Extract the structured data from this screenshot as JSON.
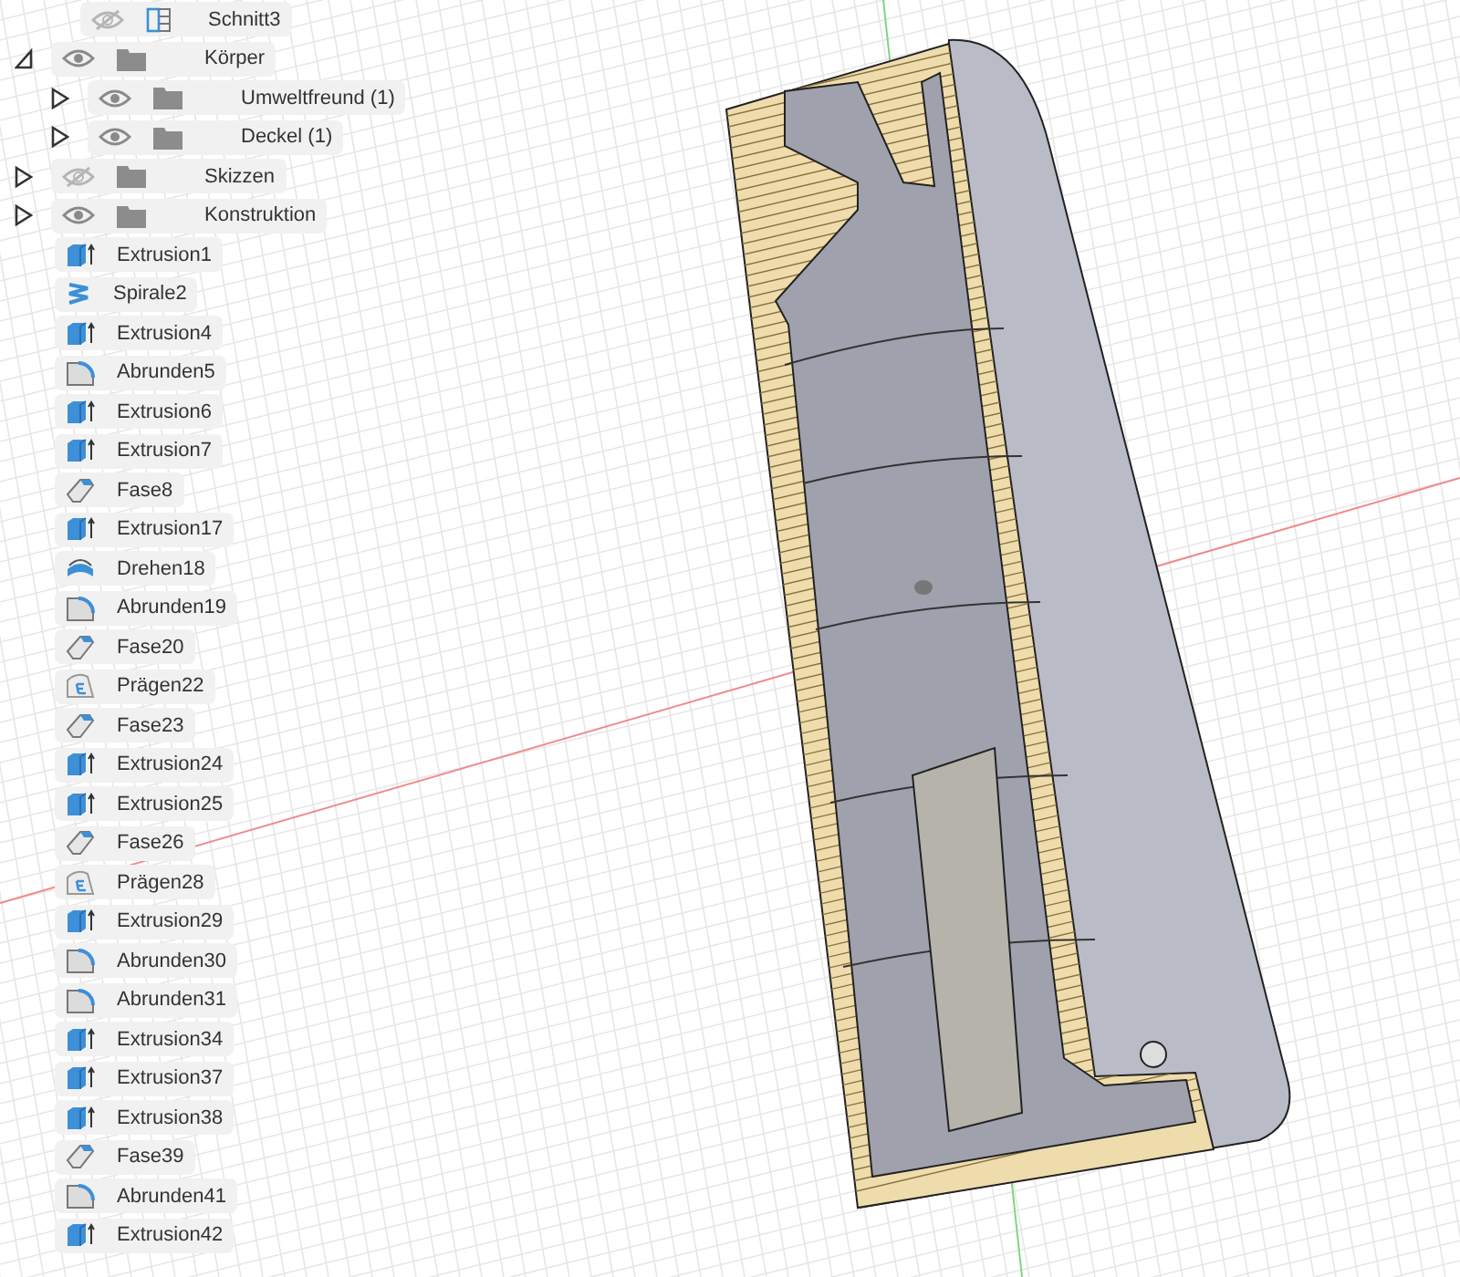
{
  "browser": {
    "sections": [
      {
        "name": "Schnitt3",
        "visible": false
      }
    ],
    "folders": [
      {
        "name": "Körper",
        "visible": true,
        "expanded": true,
        "children": [
          {
            "name": "Umweltfreund (1)",
            "visible": true,
            "expanded": false
          },
          {
            "name": "Deckel (1)",
            "visible": true,
            "expanded": false
          }
        ]
      },
      {
        "name": "Skizzen",
        "visible": false,
        "expanded": false
      },
      {
        "name": "Konstruktion",
        "visible": true,
        "expanded": false
      }
    ]
  },
  "features": [
    {
      "name": "Extrusion1",
      "kind": "extrude"
    },
    {
      "name": "Spirale2",
      "kind": "coil"
    },
    {
      "name": "Extrusion4",
      "kind": "extrude"
    },
    {
      "name": "Abrunden5",
      "kind": "fillet"
    },
    {
      "name": "Extrusion6",
      "kind": "extrude"
    },
    {
      "name": "Extrusion7",
      "kind": "extrude"
    },
    {
      "name": "Fase8",
      "kind": "chamfer"
    },
    {
      "name": "Extrusion17",
      "kind": "extrude"
    },
    {
      "name": "Drehen18",
      "kind": "revolve"
    },
    {
      "name": "Abrunden19",
      "kind": "fillet"
    },
    {
      "name": "Fase20",
      "kind": "chamfer"
    },
    {
      "name": "Prägen22",
      "kind": "emboss"
    },
    {
      "name": "Fase23",
      "kind": "chamfer"
    },
    {
      "name": "Extrusion24",
      "kind": "extrude"
    },
    {
      "name": "Extrusion25",
      "kind": "extrude"
    },
    {
      "name": "Fase26",
      "kind": "chamfer"
    },
    {
      "name": "Prägen28",
      "kind": "emboss"
    },
    {
      "name": "Extrusion29",
      "kind": "extrude"
    },
    {
      "name": "Abrunden30",
      "kind": "fillet"
    },
    {
      "name": "Abrunden31",
      "kind": "fillet"
    },
    {
      "name": "Extrusion34",
      "kind": "extrude"
    },
    {
      "name": "Extrusion37",
      "kind": "extrude"
    },
    {
      "name": "Extrusion38",
      "kind": "extrude"
    },
    {
      "name": "Fase39",
      "kind": "chamfer"
    },
    {
      "name": "Abrunden41",
      "kind": "fillet"
    },
    {
      "name": "Extrusion42",
      "kind": "extrude"
    }
  ]
}
